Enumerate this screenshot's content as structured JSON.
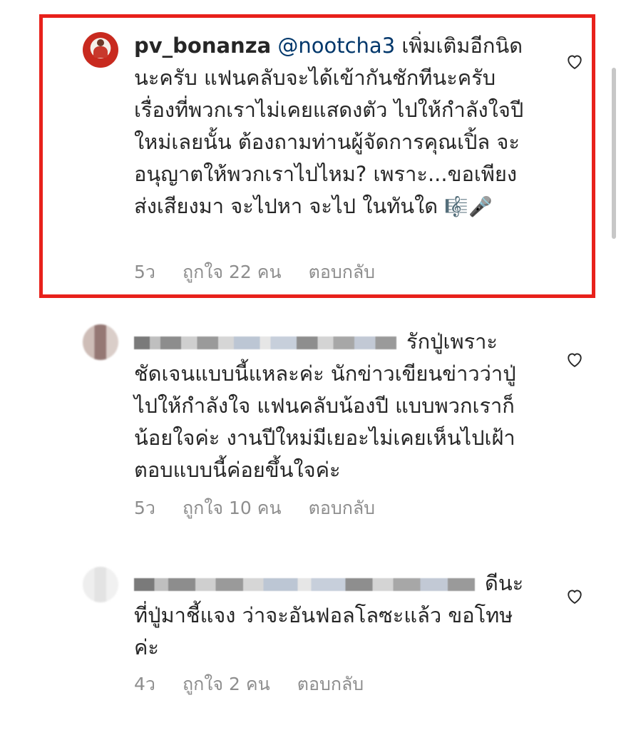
{
  "comments": [
    {
      "username": "pv_bonanza",
      "mention": "@nootcha3",
      "text": " เพิ่มเติมอีกนิดนะครับ แฟนคลับจะได้เข้ากันชักทีนะครับ เรื่องที่พวกเราไม่เคยแสดงตัว ไปให้กำลังใจปีใหม่เลยนั้น ต้องถามท่านผู้จัดการคุณเปิ้ล จะอนุญาตให้พวกเราไปไหม? เพราะ...ขอเพียงส่งเสียงมา จะไปหา จะไป ในทันใด",
      "emojis": "🎼🎤",
      "time": "5ว",
      "likes": "ถูกใจ 22 คน",
      "reply": "ตอบกลับ"
    },
    {
      "text": "รักปู่เพราะชัดเจนแบบนี้แหละค่ะ นักข่าวเขียนข่าวว่าปู่ไปให้กำลังใจ แฟนคลับน้องปี แบบพวกเราก็น้อยใจค่ะ งานปีใหม่มีเยอะไม่เคยเห็นไปเฝ้า ตอบแบบนี้ค่อยขึ้นใจค่ะ",
      "time": "5ว",
      "likes": "ถูกใจ 10 คน",
      "reply": "ตอบกลับ"
    },
    {
      "text": "ดีนะที่ปู่มาชี้แจง ว่าจะอันฟอลโลซะแล้ว ขอโทษค่ะ",
      "time": "4ว",
      "likes": "ถูกใจ 2 คน",
      "reply": "ตอบกลับ"
    }
  ],
  "icons": {
    "like": "heart-outline-icon"
  },
  "colors": {
    "highlight": "#e8211b",
    "mention": "#00376b",
    "meta": "#8e8e8e"
  }
}
